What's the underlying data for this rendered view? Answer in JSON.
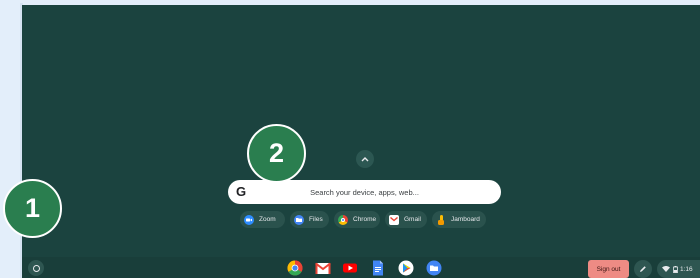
{
  "launcher": {
    "search_placeholder": "Search your device, apps, web...",
    "search_logo": "G",
    "chips": [
      {
        "label": "Zoom",
        "icon": "zoom-icon",
        "color": "#2d8cff"
      },
      {
        "label": "Files",
        "icon": "files-icon",
        "color": "#4285f4"
      },
      {
        "label": "Chrome",
        "icon": "chrome-icon",
        "color": "#34a853"
      },
      {
        "label": "Gmail",
        "icon": "gmail-icon",
        "color": "#ea4335"
      },
      {
        "label": "Jamboard",
        "icon": "jamboard-icon",
        "color": "#fbbc04"
      }
    ]
  },
  "shelf": {
    "apps": [
      "chrome-icon",
      "gmail-icon",
      "youtube-icon",
      "docs-icon",
      "play-store-icon",
      "files-icon"
    ],
    "sign_out_label": "Sign out",
    "time": "1:16"
  },
  "annotations": {
    "badge_1": "1",
    "badge_2": "2"
  },
  "colors": {
    "wallpaper": "#1b433f",
    "sign_out_bg": "#ee8b84",
    "badge_bg": "#2a7e4f"
  }
}
